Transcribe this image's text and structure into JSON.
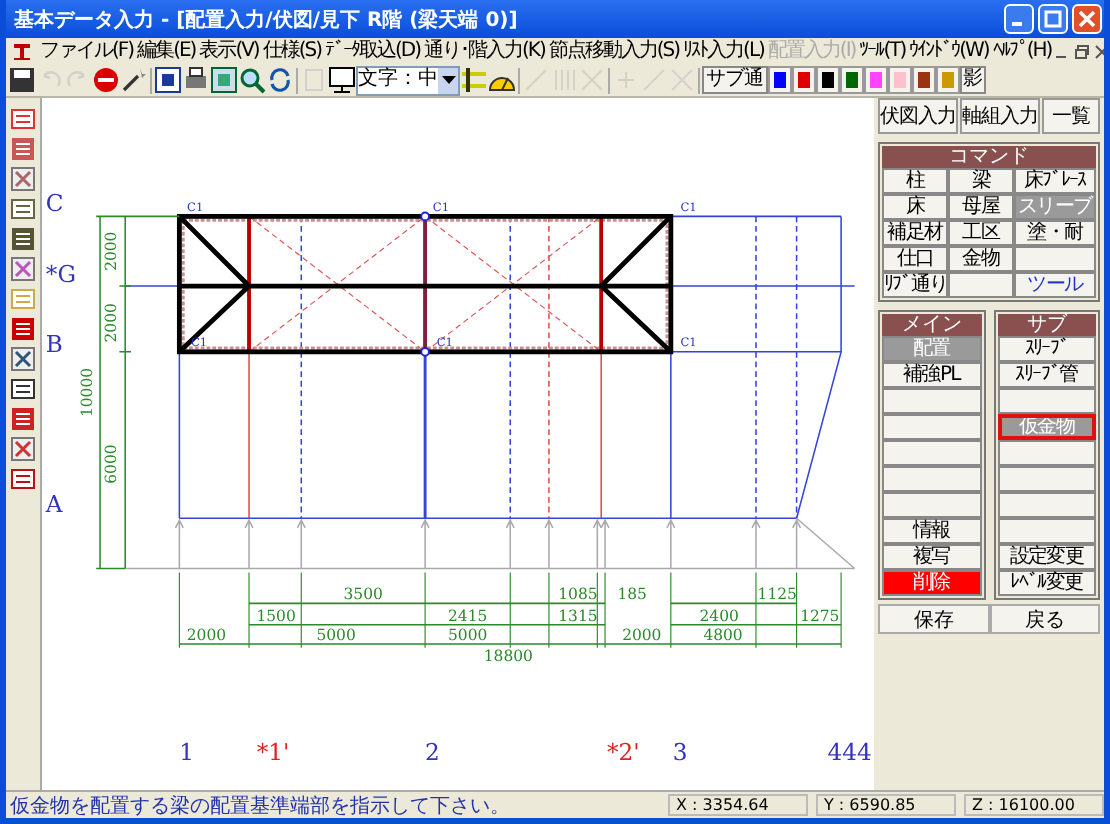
{
  "window": {
    "title": "基本データ入力 - [配置入力/伏図/見下 R階 (梁天端 0)]"
  },
  "menu": [
    {
      "label": "ファイル(F)",
      "disabled": false
    },
    {
      "label": "編集(E)",
      "disabled": false
    },
    {
      "label": "表示(V)",
      "disabled": false
    },
    {
      "label": "仕様(S)",
      "disabled": false
    },
    {
      "label": "ﾃﾞｰﾀ取込(D)",
      "disabled": false
    },
    {
      "label": "通り･階入力(K)",
      "disabled": false
    },
    {
      "label": "節点移動入力(S)",
      "disabled": false
    },
    {
      "label": "ﾘｽﾄ入力(L)",
      "disabled": false
    },
    {
      "label": "配置入力(I)",
      "disabled": true
    },
    {
      "label": "ﾂｰﾙ(T)",
      "disabled": false
    },
    {
      "label": "ｳｲﾝﾄﾞｳ(W)",
      "disabled": false
    },
    {
      "label": "ﾍﾙﾌﾟ(H)",
      "disabled": false
    }
  ],
  "toolbar": [
    {
      "kind": "save",
      "disabled": false
    },
    {
      "kind": "undo",
      "disabled": true
    },
    {
      "kind": "redo",
      "disabled": true
    },
    {
      "kind": "stop",
      "disabled": false
    },
    {
      "kind": "wand",
      "disabled": false
    },
    {
      "kind": "separator"
    },
    {
      "kind": "grid",
      "disabled": false
    },
    {
      "kind": "print",
      "disabled": false
    },
    {
      "kind": "window",
      "disabled": false
    },
    {
      "kind": "magnifier",
      "disabled": false
    },
    {
      "kind": "refresh",
      "disabled": false
    },
    {
      "kind": "separator"
    },
    {
      "kind": "page",
      "disabled": true
    },
    {
      "kind": "monitor",
      "disabled": false
    },
    {
      "kind": "select",
      "value": "文字：中"
    },
    {
      "kind": "beam",
      "disabled": false
    },
    {
      "kind": "gauge",
      "disabled": false
    },
    {
      "kind": "separator"
    },
    {
      "kind": "line",
      "disabled": true
    },
    {
      "kind": "hatch",
      "disabled": true
    },
    {
      "kind": "cross",
      "disabled": true
    },
    {
      "kind": "separator"
    },
    {
      "kind": "plus",
      "disabled": true
    },
    {
      "kind": "line",
      "disabled": true
    },
    {
      "kind": "cross",
      "disabled": true
    },
    {
      "kind": "separator"
    },
    {
      "kind": "text",
      "label": "サブ通"
    },
    {
      "kind": "swatch",
      "color": "#0000ff"
    },
    {
      "kind": "swatch",
      "color": "#dd0000"
    },
    {
      "kind": "swatch",
      "color": "#000000"
    },
    {
      "kind": "swatch",
      "color": "#006600"
    },
    {
      "kind": "swatch",
      "color": "#ff44ff"
    },
    {
      "kind": "swatch",
      "color": "#ffc0cb"
    },
    {
      "kind": "swatch",
      "color": "#993311"
    },
    {
      "kind": "swatch",
      "color": "#cc9900"
    },
    {
      "kind": "text",
      "label": "影"
    }
  ],
  "drawing": {
    "row_axes": [
      {
        "label": "C",
        "color": "#3333bb"
      },
      {
        "label": "*G",
        "color": "#3333bb"
      },
      {
        "label": "B",
        "color": "#3333bb"
      },
      {
        "label": "A",
        "color": "#3333bb"
      }
    ],
    "column_axes": [
      {
        "label": "1",
        "color": "#3333bb"
      },
      {
        "label": "*1'",
        "color": "#dd2222"
      },
      {
        "label": "2",
        "color": "#3333bb"
      },
      {
        "label": "*2'",
        "color": "#dd2222"
      },
      {
        "label": "3",
        "color": "#3333bb"
      },
      {
        "label": "444",
        "color": "#3333bb"
      }
    ],
    "vertical_dimensions": [
      "2000",
      "2000",
      "10000",
      "6000"
    ],
    "dimension_rows": [
      [
        "3500",
        "1085",
        "185",
        "1125"
      ],
      [
        "1500",
        "2415",
        "1315",
        "2400",
        "1275"
      ],
      [
        "2000",
        "5000",
        "5000",
        "2000",
        "4800"
      ]
    ],
    "total_dimension": "18800",
    "member_labels": [
      "C1",
      "C1",
      "C1",
      "C1",
      "C1",
      "C1"
    ]
  },
  "panel": {
    "tabs": [
      {
        "label": "伏図入力",
        "selected": false
      },
      {
        "label": "軸組入力",
        "selected": false
      },
      {
        "label": "一覧",
        "selected": false
      }
    ],
    "command_header": "コマンド",
    "commands": [
      {
        "label": "柱",
        "kind": "button",
        "selected": false
      },
      {
        "label": "梁",
        "kind": "button",
        "selected": false
      },
      {
        "label": "床ﾌﾞﾚｰｽ",
        "kind": "button",
        "selected": false
      },
      {
        "label": "床",
        "kind": "button",
        "selected": false
      },
      {
        "label": "母屋",
        "kind": "button",
        "selected": false
      },
      {
        "label": "スリーブ",
        "kind": "button",
        "selected": true
      },
      {
        "label": "補足材",
        "kind": "button",
        "selected": false
      },
      {
        "label": "工区",
        "kind": "button",
        "selected": false
      },
      {
        "label": "塗・耐",
        "kind": "button",
        "selected": false
      },
      {
        "label": "仕口",
        "kind": "button",
        "selected": false
      },
      {
        "label": "金物",
        "kind": "button",
        "selected": false
      },
      {
        "kind": "empty",
        "selected": false
      },
      {
        "label": "ﾘﾌﾞ通り",
        "kind": "button",
        "selected": false
      },
      {
        "kind": "empty",
        "selected": false
      },
      {
        "label": "ツール",
        "kind": "tool",
        "selected": false
      }
    ],
    "main_header": "メイン",
    "sub_header": "サブ",
    "main_items": [
      {
        "label": "配置",
        "kind": "button",
        "selected": true
      },
      {
        "label": "補強PL",
        "kind": "button",
        "selected": false
      },
      {
        "kind": "empty",
        "selected": false
      },
      {
        "kind": "empty",
        "selected": false
      },
      {
        "kind": "empty",
        "selected": false
      },
      {
        "kind": "empty",
        "selected": false
      },
      {
        "kind": "empty",
        "selected": false
      },
      {
        "label": "情報",
        "kind": "button",
        "selected": false
      },
      {
        "label": "複写",
        "kind": "button",
        "selected": false
      },
      {
        "label": "削除",
        "kind": "danger",
        "selected": false
      }
    ],
    "sub_items": [
      {
        "label": "ｽﾘｰﾌﾞ",
        "kind": "button",
        "selected": false,
        "focused": false
      },
      {
        "label": "ｽﾘｰﾌﾞ管",
        "kind": "button",
        "selected": false,
        "focused": false
      },
      {
        "kind": "empty",
        "selected": false,
        "focused": false
      },
      {
        "label": "仮金物",
        "kind": "button",
        "selected": true,
        "focused": true
      },
      {
        "kind": "empty",
        "selected": false,
        "focused": false
      },
      {
        "kind": "empty",
        "selected": false,
        "focused": false
      },
      {
        "kind": "empty",
        "selected": false,
        "focused": false
      },
      {
        "kind": "empty",
        "selected": false,
        "focused": false
      },
      {
        "label": "設定変更",
        "kind": "button",
        "selected": false,
        "focused": false
      },
      {
        "label": "ﾚﾍﾞﾙ変更",
        "kind": "button",
        "selected": false,
        "focused": false
      }
    ],
    "footer_buttons": [
      "保存",
      "戻る"
    ]
  },
  "status_bar": {
    "message": "仮金物を配置する梁の配置基準端部を指示して下さい。",
    "x": "X : 3354.64",
    "y": "Y : 6590.85",
    "z": "Z : 16100.00"
  }
}
